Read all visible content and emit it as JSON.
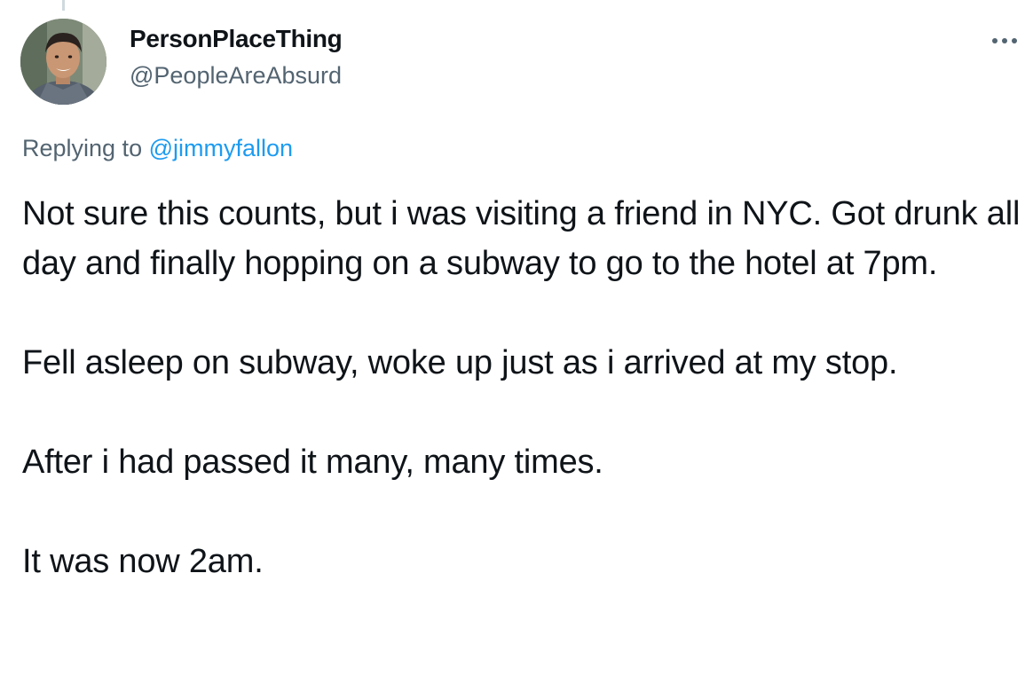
{
  "tweet": {
    "author": {
      "display_name": "PersonPlaceThing",
      "handle": "@PeopleAreAbsurd",
      "avatar_icon": "user-avatar-photo"
    },
    "more_icon": "more-horizontal-icon",
    "reply": {
      "prefix": "Replying to",
      "mention": "@jimmyfallon"
    },
    "paragraphs": [
      "Not sure this counts, but i was visiting a friend in NYC. Got drunk all day and finally hopping on a subway to go to the hotel at 7pm.",
      "Fell asleep on subway, woke up just as i arrived at my stop.",
      "After i had passed it many, many times.",
      "It was now 2am."
    ]
  },
  "colors": {
    "text_primary": "#0f1419",
    "text_secondary": "#536471",
    "link": "#1d9bf0",
    "thread_line": "#cfd9de"
  }
}
